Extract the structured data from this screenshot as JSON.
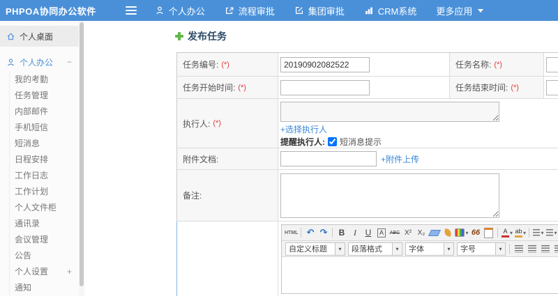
{
  "colors": {
    "accent": "#4a90d9",
    "link": "#3a87d8",
    "required": "#e23c3c",
    "topbar_bg": "#4a90d9"
  },
  "topbar": {
    "title": "PHPOA协同办公软件",
    "nav": [
      {
        "label": "个人办公",
        "icon": "user-icon"
      },
      {
        "label": "流程审批",
        "icon": "flow-approve-icon"
      },
      {
        "label": "集团审批",
        "icon": "group-approve-icon"
      },
      {
        "label": "CRM系统",
        "icon": "bar-chart-icon"
      },
      {
        "label": "更多应用",
        "icon": "caret-down-icon"
      }
    ]
  },
  "sidebar": {
    "desktop": "个人桌面",
    "section": "个人办公",
    "collapse": "−",
    "items": [
      "我的考勤",
      "任务管理",
      "内部邮件",
      "手机短信",
      "短消息",
      "日程安排",
      "工作日志",
      "工作计划",
      "个人文件柜",
      "通讯录",
      "会议管理",
      "公告"
    ],
    "settings": "个人设置",
    "expand": "+",
    "notice": "通知"
  },
  "form": {
    "title": "发布任务",
    "req": "(*)",
    "task_no": {
      "label": "任务编号:",
      "value": "20190902082522"
    },
    "task_name": {
      "label": "任务名称:"
    },
    "start": {
      "label": "任务开始时间:"
    },
    "end": {
      "label": "任务结束时间:"
    },
    "executor": {
      "label": "执行人:",
      "select": "+选择执行人",
      "remind": "提醒执行人:",
      "sms": "短消息提示",
      "sms_checked": "checked"
    },
    "attach": {
      "label": "附件文档:",
      "upload": "+附件上传"
    },
    "remark": {
      "label": "备注:"
    }
  },
  "editor": {
    "glyphs": {
      "html": "HTML",
      "undo": "↶",
      "redo": "↷",
      "bold": "B",
      "italic": "I",
      "underline": "U",
      "fontbox": "A",
      "strike": "ABC",
      "sup": "X²",
      "sub": "X₂",
      "quote": "66",
      "fontcolor": "A",
      "hilite": "ab",
      "caret": "▾",
      "chain": "∞",
      "unlink": "∞"
    },
    "dropdowns": [
      "自定义标题",
      "段落格式",
      "字体",
      "字号"
    ]
  }
}
